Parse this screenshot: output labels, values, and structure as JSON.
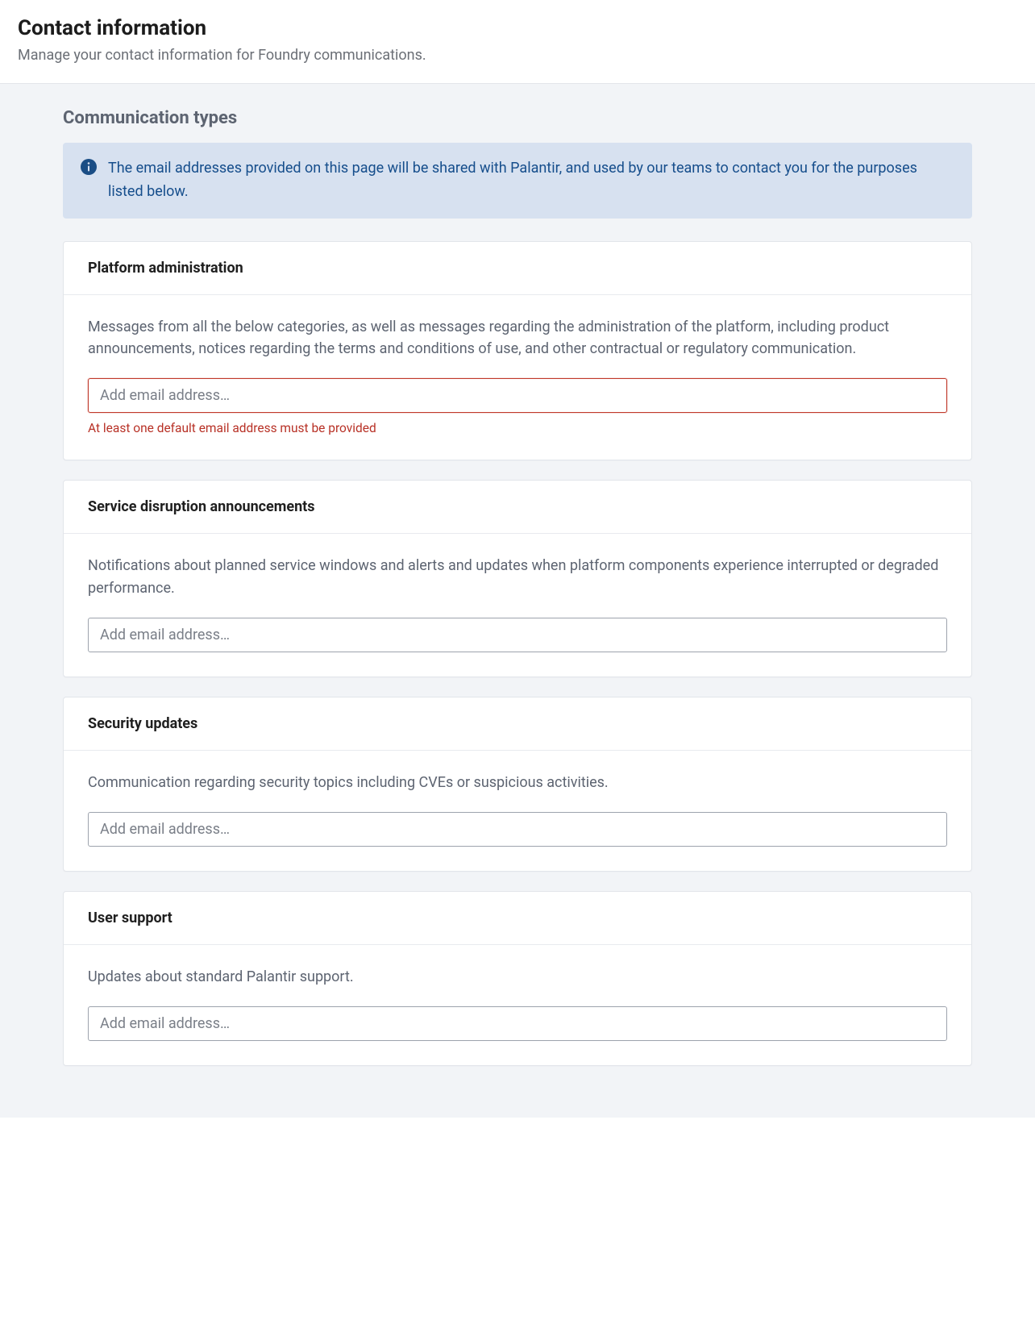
{
  "header": {
    "title": "Contact information",
    "subtitle": "Manage your contact information for Foundry communications."
  },
  "section_heading": "Communication types",
  "info_callout": "The email addresses provided on this page will be shared with Palantir, and used by our teams to contact you for the purposes listed below.",
  "cards": [
    {
      "title": "Platform administration",
      "description": "Messages from all the below categories, as well as messages regarding the administration of the platform, including product announcements, notices regarding the terms and conditions of use, and other contractual or regulatory communication.",
      "placeholder": "Add email address…",
      "error": "At least one default email address must be provided",
      "has_error": true
    },
    {
      "title": "Service disruption announcements",
      "description": "Notifications about planned service windows and alerts and updates when platform components experience interrupted or degraded performance.",
      "placeholder": "Add email address…",
      "error": "",
      "has_error": false
    },
    {
      "title": "Security updates",
      "description": "Communication regarding security topics including CVEs or suspicious activities.",
      "placeholder": "Add email address…",
      "error": "",
      "has_error": false
    },
    {
      "title": "User support",
      "description": "Updates about standard Palantir support.",
      "placeholder": "Add email address…",
      "error": "",
      "has_error": false
    }
  ]
}
